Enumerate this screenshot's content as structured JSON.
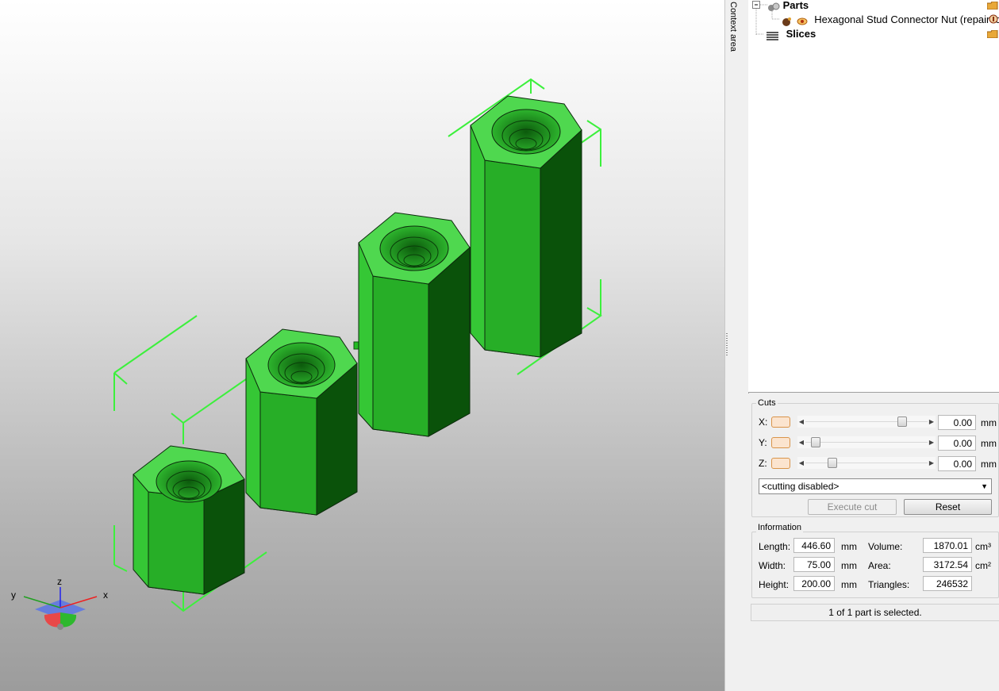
{
  "tree": {
    "parts_label": "Parts",
    "part_name": "Hexagonal Stud Connector Nut (repaired)",
    "slices_label": "Slices"
  },
  "context_area_label": "Context area",
  "cuts": {
    "title": "Cuts",
    "x_label": "X:",
    "y_label": "Y:",
    "z_label": "Z:",
    "x_value": "0.00",
    "y_value": "0.00",
    "z_value": "0.00",
    "unit": "mm",
    "mode_selected": "<cutting disabled>",
    "execute_label": "Execute cut",
    "reset_label": "Reset"
  },
  "information": {
    "title": "Information",
    "length_label": "Length:",
    "length_value": "446.60",
    "width_label": "Width:",
    "width_value": "75.00",
    "height_label": "Height:",
    "height_value": "200.00",
    "mm_unit": "mm",
    "volume_label": "Volume:",
    "volume_value": "1870.01",
    "volume_unit": "cm³",
    "area_label": "Area:",
    "area_value": "3172.54",
    "area_unit": "cm²",
    "triangles_label": "Triangles:",
    "triangles_value": "246532"
  },
  "status_text": "1 of 1 part is selected.",
  "axes": {
    "x": "x",
    "y": "y",
    "z": "z"
  },
  "colors": {
    "model_green": "#22bb22",
    "selection_green": "#33ee33"
  }
}
